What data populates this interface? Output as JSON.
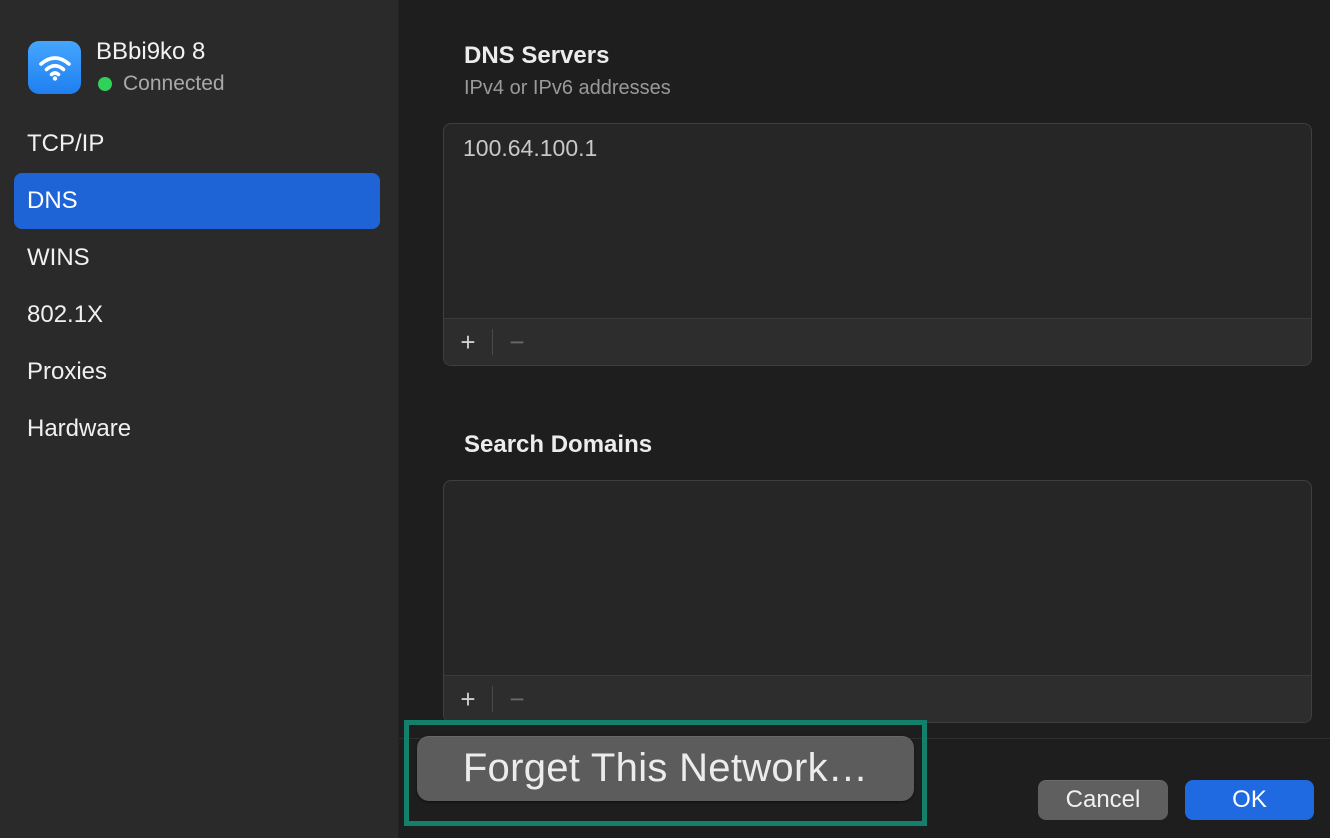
{
  "network": {
    "name": "BBbi9ko 8",
    "status": "Connected",
    "icon": "wifi-icon",
    "status_color": "#30d158"
  },
  "sidebar": {
    "items": [
      {
        "label": "TCP/IP",
        "selected": false
      },
      {
        "label": "DNS",
        "selected": true
      },
      {
        "label": "WINS",
        "selected": false
      },
      {
        "label": "802.1X",
        "selected": false
      },
      {
        "label": "Proxies",
        "selected": false
      },
      {
        "label": "Hardware",
        "selected": false
      }
    ]
  },
  "dns_servers": {
    "title": "DNS Servers",
    "subtitle": "IPv4 or IPv6 addresses",
    "entries": [
      "100.64.100.1"
    ],
    "add_label": "+",
    "remove_label": "−"
  },
  "search_domains": {
    "title": "Search Domains",
    "entries": [],
    "add_label": "+",
    "remove_label": "−"
  },
  "footer": {
    "forget_label": "Forget This Network…",
    "cancel_label": "Cancel",
    "ok_label": "OK"
  },
  "colors": {
    "accent": "#1f64d6",
    "highlight": "#13806b"
  }
}
